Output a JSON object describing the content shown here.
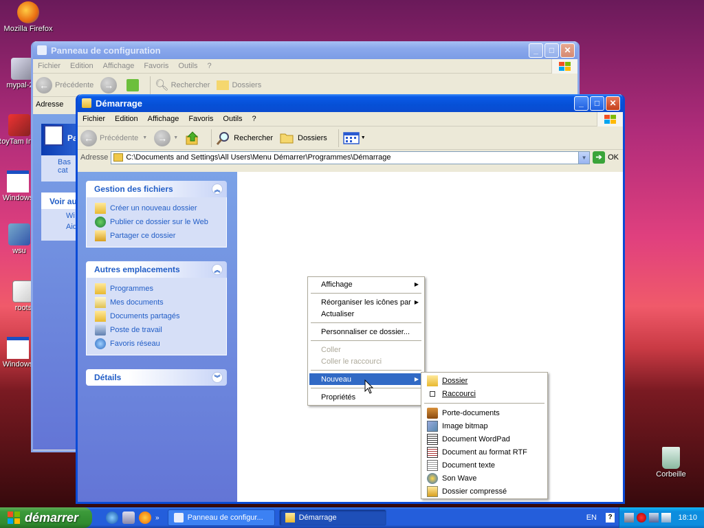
{
  "desktop": {
    "icons": [
      {
        "label": "Mozilla Firefox"
      },
      {
        "label": "mypal-29"
      },
      {
        "label": "RoyTam Insta"
      },
      {
        "label": "Windows"
      },
      {
        "label": "wsu"
      },
      {
        "label": "roots"
      },
      {
        "label": "Windows"
      },
      {
        "label": "Corbeille"
      }
    ]
  },
  "back_window": {
    "title": "Panneau de configuration",
    "menu": [
      "Fichier",
      "Edition",
      "Affichage",
      "Favoris",
      "Outils",
      "?"
    ],
    "toolbar": {
      "back": "Précédente",
      "search": "Rechercher",
      "folders": "Dossiers"
    },
    "address_label": "Adresse",
    "pane_title": "Pa",
    "pane_links": [
      "Bas",
      "cat"
    ],
    "see_also": "Voir au",
    "see_also_links": [
      "Wi",
      "Aid"
    ]
  },
  "main_window": {
    "title": "Démarrage",
    "menu": [
      "Fichier",
      "Edition",
      "Affichage",
      "Favoris",
      "Outils",
      "?"
    ],
    "toolbar": {
      "back": "Précédente",
      "search": "Rechercher",
      "folders": "Dossiers"
    },
    "address_label": "Adresse",
    "address_value": "C:\\Documents and Settings\\All Users\\Menu Démarrer\\Programmes\\Démarrage",
    "go_label": "OK",
    "task_pane": {
      "file_tasks": {
        "title": "Gestion des fichiers",
        "links": [
          "Créer un nouveau dossier",
          "Publier ce dossier sur le Web",
          "Partager ce dossier"
        ]
      },
      "other_places": {
        "title": "Autres emplacements",
        "links": [
          "Programmes",
          "Mes documents",
          "Documents partagés",
          "Poste de travail",
          "Favoris réseau"
        ]
      },
      "details": {
        "title": "Détails"
      }
    }
  },
  "context_menu": {
    "items": [
      "Affichage",
      "Réorganiser les icônes par",
      "Actualiser",
      "Personnaliser ce dossier...",
      "Coller",
      "Coller le raccourci",
      "Nouveau",
      "Propriétés"
    ]
  },
  "submenu": {
    "items": [
      "Dossier",
      "Raccourci",
      "Porte-documents",
      "Image bitmap",
      "Document WordPad",
      "Document au format RTF",
      "Document texte",
      "Son Wave",
      "Dossier compressé"
    ]
  },
  "taskbar": {
    "start_label": "démarrer",
    "tasks": [
      "Panneau de configur...",
      "Démarrage"
    ],
    "lang": "EN",
    "clock": "18:10"
  }
}
